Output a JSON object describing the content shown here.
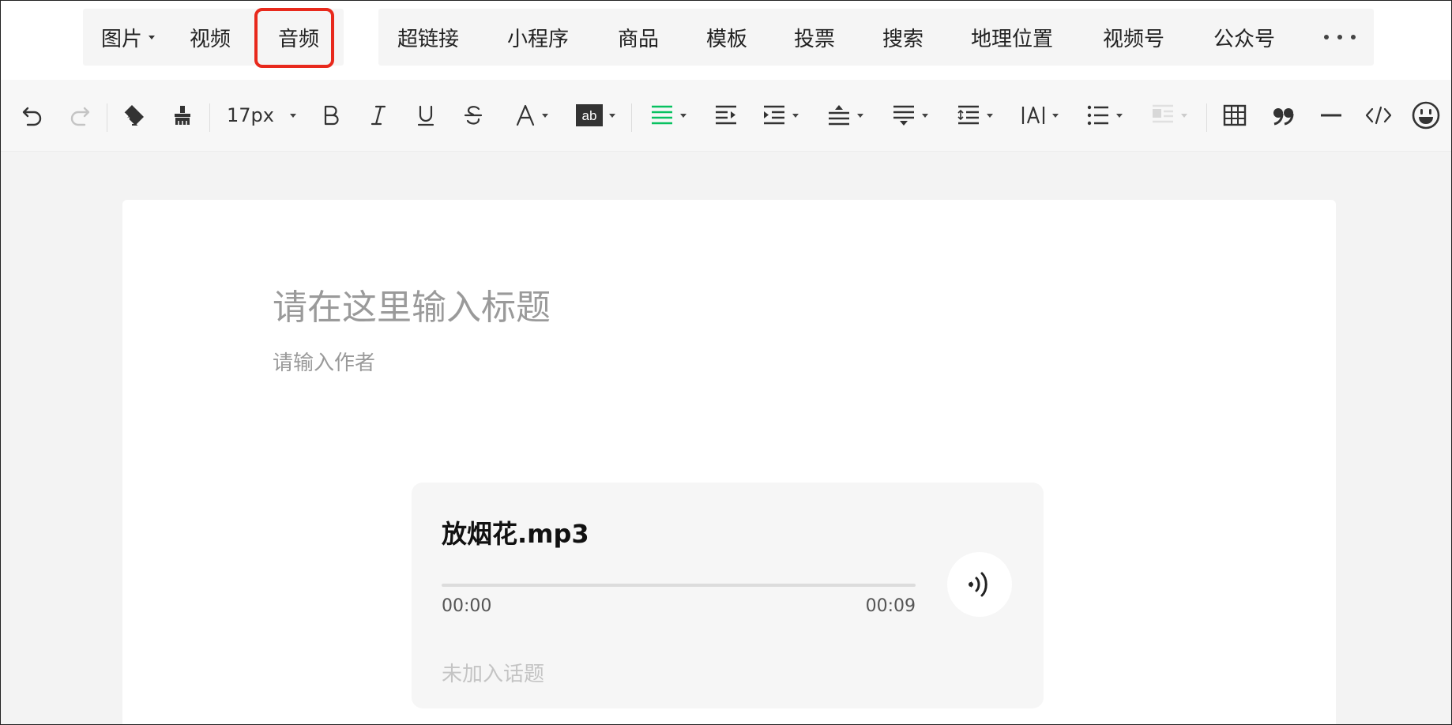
{
  "insert_bar": {
    "items": [
      {
        "label": "图片",
        "has_dropdown": true
      },
      {
        "label": "视频"
      },
      {
        "label": "音频",
        "highlighted": true
      },
      {
        "label": "超链接"
      },
      {
        "label": "小程序"
      },
      {
        "label": "商品"
      },
      {
        "label": "模板"
      },
      {
        "label": "投票"
      },
      {
        "label": "搜索"
      },
      {
        "label": "地理位置"
      },
      {
        "label": "视频号"
      },
      {
        "label": "公众号"
      }
    ],
    "more_icon": "more-horizontal-icon",
    "highlight_color": "#e8291c"
  },
  "toolbar": {
    "font_size": "17px",
    "icons": [
      "undo-icon",
      "redo-icon",
      "eraser-icon",
      "format-brush-icon",
      "bold-icon",
      "italic-icon",
      "underline-icon",
      "strikethrough-icon",
      "font-color-icon",
      "background-color-icon",
      "align-justify-icon",
      "indent-icon",
      "align-dropdown-icon",
      "paragraph-spacing-top-icon",
      "paragraph-spacing-bottom-icon",
      "line-height-icon",
      "letter-spacing-icon",
      "list-icon",
      "image-float-icon",
      "table-icon",
      "quote-icon",
      "divider-icon",
      "code-icon",
      "emoji-icon"
    ],
    "active_color": "#07c160"
  },
  "editor": {
    "title_placeholder": "请在这里输入标题",
    "author_placeholder": "请输入作者",
    "audio": {
      "filename": "放烟花.mp3",
      "current_time": "00:00",
      "duration": "00:09",
      "progress": 0,
      "topic": "未加入话题"
    }
  }
}
